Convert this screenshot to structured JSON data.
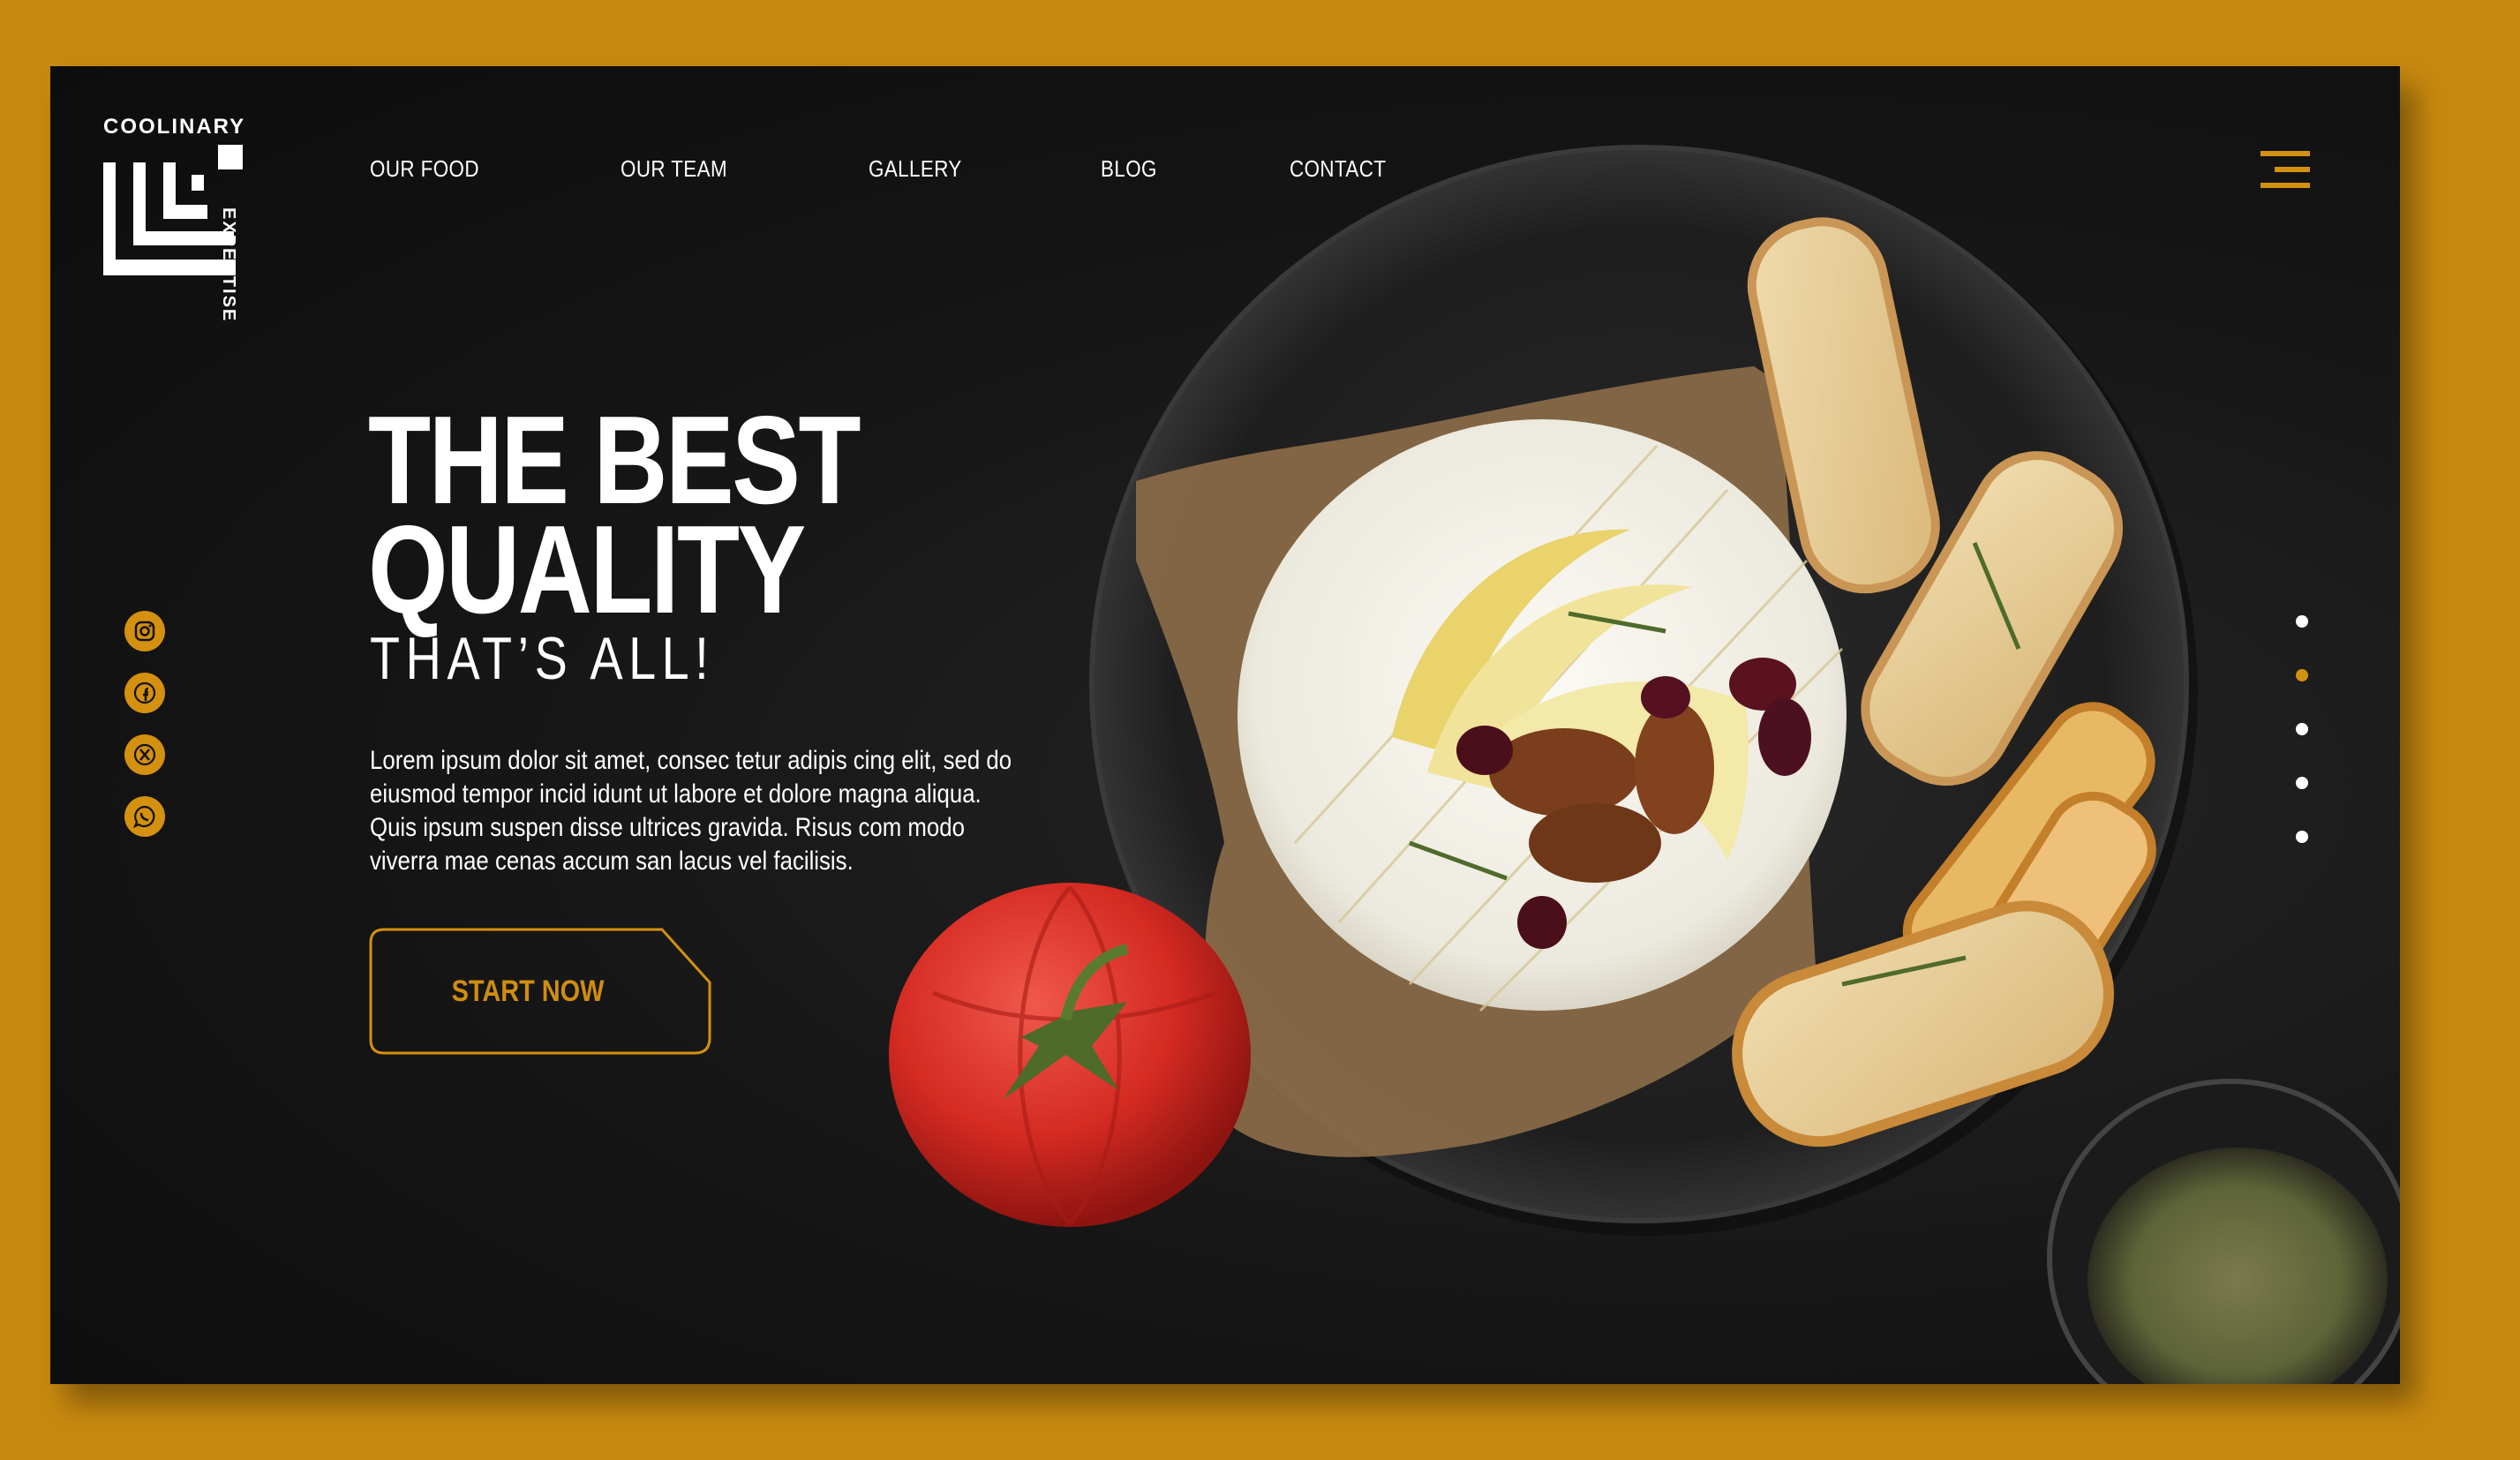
{
  "brand": {
    "top": "COOLINARY",
    "side": "EXPERTISE"
  },
  "nav": {
    "items": [
      "OUR FOOD",
      "OUR TEAM",
      "GALLERY",
      "BLOG",
      "CONTACT"
    ]
  },
  "hero": {
    "title_line1": "THE BEST",
    "title_line2": "QUALITY",
    "subtitle": "THAT’S ALL!",
    "description": "Lorem ipsum dolor sit amet, consec tetur adipis cing elit, sed do eiusmod tempor incid idunt ut labore et dolore magna aliqua. Quis ipsum suspen disse ultrices gravida. Risus com modo viverra mae cenas accum san lacus vel facilisis.",
    "cta": "START NOW"
  },
  "social": [
    "instagram-icon",
    "facebook-icon",
    "x-icon",
    "whatsapp-icon"
  ],
  "pager": {
    "count": 5,
    "active_index": 1
  },
  "colors": {
    "accent": "#d4900f",
    "background": "#c8890f",
    "panel": "#151515"
  }
}
